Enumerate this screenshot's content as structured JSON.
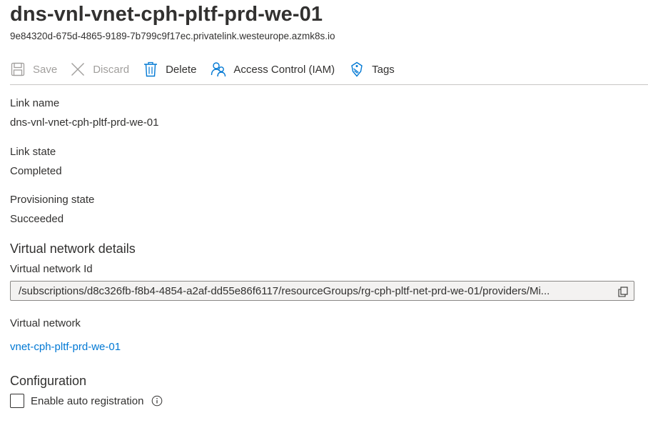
{
  "header": {
    "title": "dns-vnl-vnet-cph-pltf-prd-we-01",
    "subtitle": "9e84320d-675d-4865-9189-7b799c9f17ec.privatelink.westeurope.azmk8s.io"
  },
  "toolbar": {
    "save": {
      "label": "Save",
      "icon": "save-icon",
      "enabled": false
    },
    "discard": {
      "label": "Discard",
      "icon": "close-icon",
      "enabled": false
    },
    "delete": {
      "label": "Delete",
      "icon": "trash-icon",
      "enabled": true
    },
    "access_control": {
      "label": "Access Control (IAM)",
      "icon": "people-icon",
      "enabled": true
    },
    "tags": {
      "label": "Tags",
      "icon": "tag-icon",
      "enabled": true
    }
  },
  "fields": {
    "link_name": {
      "label": "Link name",
      "value": "dns-vnl-vnet-cph-pltf-prd-we-01"
    },
    "link_state": {
      "label": "Link state",
      "value": "Completed"
    },
    "provisioning_state": {
      "label": "Provisioning state",
      "value": "Succeeded"
    }
  },
  "virtual_network_details": {
    "heading": "Virtual network details",
    "vnet_id_label": "Virtual network Id",
    "vnet_id_value": "/subscriptions/d8c326fb-f8b4-4854-a2af-dd55e86f6117/resourceGroups/rg-cph-pltf-net-prd-we-01/providers/Mi...",
    "vnet_label": "Virtual network",
    "vnet_link": "vnet-cph-pltf-prd-we-01"
  },
  "configuration": {
    "heading": "Configuration",
    "auto_registration_label": "Enable auto registration",
    "auto_registration_checked": false
  },
  "colors": {
    "accent": "#0078d4",
    "text": "#323130",
    "disabled_text": "#a19f9d",
    "readonly_bg": "#f3f2f1"
  }
}
